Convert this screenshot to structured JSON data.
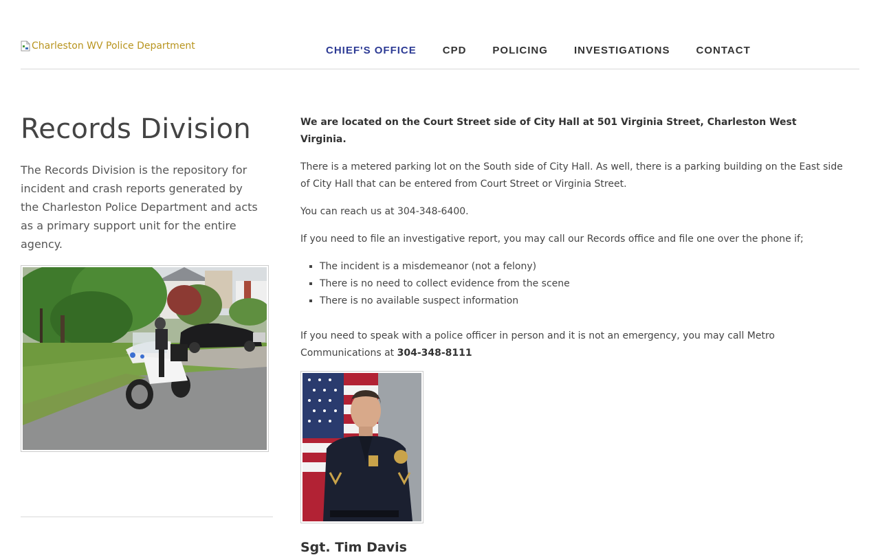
{
  "header": {
    "logo_alt": "Charleston WV Police Department",
    "nav": [
      {
        "label": "CHIEF'S OFFICE",
        "active": true
      },
      {
        "label": "CPD",
        "active": false
      },
      {
        "label": "POLICING",
        "active": false
      },
      {
        "label": "INVESTIGATIONS",
        "active": false
      },
      {
        "label": "CONTACT",
        "active": false
      }
    ]
  },
  "left": {
    "title": "Records Division",
    "intro": "The Records Division is the repository for incident and crash reports generated by the Charleston Police Department and acts as a primary support unit for the entire agency."
  },
  "main": {
    "location": "We are located on the Court Street side of City Hall at 501 Virginia Street, Charleston West Virginia.",
    "parking": "There is a metered parking lot on the South side of City Hall. As well, there is a parking building on the East side of City Hall that can be entered from Court Street or Virginia Street.",
    "reach": "You can reach us at 304-348-6400.",
    "file_report": "If you need to file an investigative report, you may call our Records office and file one over the phone if;",
    "conditions": [
      "The incident is a misdemeanor (not a felony)",
      "There is no need to collect evidence from the scene",
      "There is no available suspect information"
    ],
    "speak_officer": "If you need to speak with a police officer in person and it is not an emergency, you may call Metro Communications at ",
    "metro_phone": "304-348-8111",
    "officer_name": "Sgt. Tim Davis"
  },
  "colors": {
    "nav_active": "#2c3a94",
    "logo_text": "#b8941e"
  }
}
